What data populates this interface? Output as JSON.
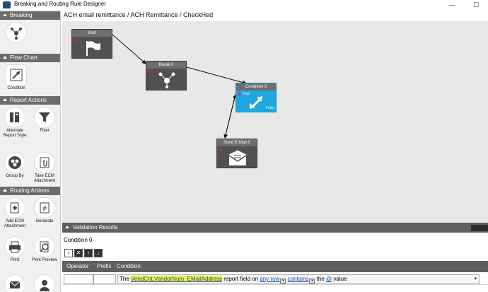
{
  "window": {
    "title": "Breaking and Routing Rule Designer"
  },
  "breadcrumb": "ACH email remittance / ACH Remittance / CheckHed",
  "sidebar": {
    "sections": [
      {
        "label": "Breaking",
        "tools": [
          {
            "label": "Break",
            "icon": "break-icon"
          }
        ]
      },
      {
        "label": "Flow Chart",
        "tools": [
          {
            "label": "Condition",
            "icon": "condition-icon"
          }
        ]
      },
      {
        "label": "Report Actions",
        "tools": [
          {
            "label": "Alternate Report Style",
            "icon": "alternate-style-icon"
          },
          {
            "label": "Filter",
            "icon": "filter-icon"
          },
          {
            "label": "Group By",
            "icon": "group-by-icon"
          },
          {
            "label": "Take ECM Attachment",
            "icon": "attachment-icon"
          }
        ]
      },
      {
        "label": "Routing Actions",
        "tools": [
          {
            "label": "Add ECM Attachment",
            "icon": "add-document-icon"
          },
          {
            "label": "Generate",
            "icon": "generate-icon"
          },
          {
            "label": "Print",
            "icon": "printer-icon"
          },
          {
            "label": "Print Preview",
            "icon": "print-preview-icon"
          }
        ]
      }
    ]
  },
  "canvas": {
    "nodes": [
      {
        "id": "start",
        "label": "Start",
        "icon": "flag-icon"
      },
      {
        "id": "break0",
        "label": "Break 0",
        "icon": "break-icon"
      },
      {
        "id": "cond0",
        "label": "Condition 0",
        "icon": "condition-icon",
        "true_label": "True",
        "false_label": "False",
        "active": true
      },
      {
        "id": "email0",
        "label": "Send E-Mail 0",
        "icon": "email-icon"
      }
    ],
    "accent_color": "#1ea7e1"
  },
  "validation": {
    "header": "Validation Results",
    "tab": "Condition 0",
    "columns": [
      "Operator",
      "Prefix",
      "Condition"
    ],
    "row": {
      "prefix_text": "The",
      "field": "VendCnt.VendorNum_EMailAddress",
      "mid1": "report field on",
      "link1": "any row",
      "link2": "contains",
      "mid2": "the",
      "link3": "@",
      "suffix": "value"
    }
  }
}
